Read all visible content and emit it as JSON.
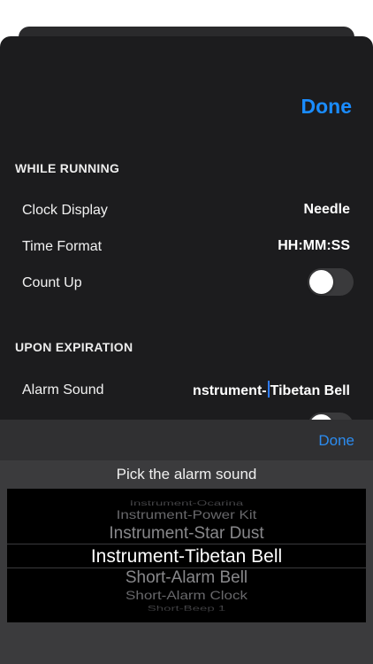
{
  "header": {
    "done_label": "Done"
  },
  "while_running": {
    "title": "WHILE RUNNING",
    "clock_display": {
      "label": "Clock Display",
      "value": "Needle"
    },
    "time_format": {
      "label": "Time Format",
      "value": "HH:MM:SS"
    },
    "count_up": {
      "label": "Count Up",
      "on": false
    }
  },
  "upon_expiration": {
    "title": "UPON EXPIRATION",
    "alarm_sound": {
      "label": "Alarm Sound",
      "value_before_cursor": "nstrument-",
      "value_after_cursor": "Tibetan Bell"
    },
    "second_toggle": {
      "on": false
    }
  },
  "picker": {
    "done_label": "Done",
    "prompt": "Pick the alarm sound",
    "items": [
      "Instrument-Ocarina",
      "Instrument-Power Kit",
      "Instrument-Star Dust",
      "Instrument-Tibetan Bell",
      "Short-Alarm Bell",
      "Short-Alarm Clock",
      "Short-Beep 1"
    ],
    "selected": "Instrument-Tibetan Bell"
  },
  "colors": {
    "accent": "#1a8cff",
    "sheet_background": "#1c1c1e",
    "picker_background": "#3b3b3d",
    "wheel_background": "#000000"
  }
}
